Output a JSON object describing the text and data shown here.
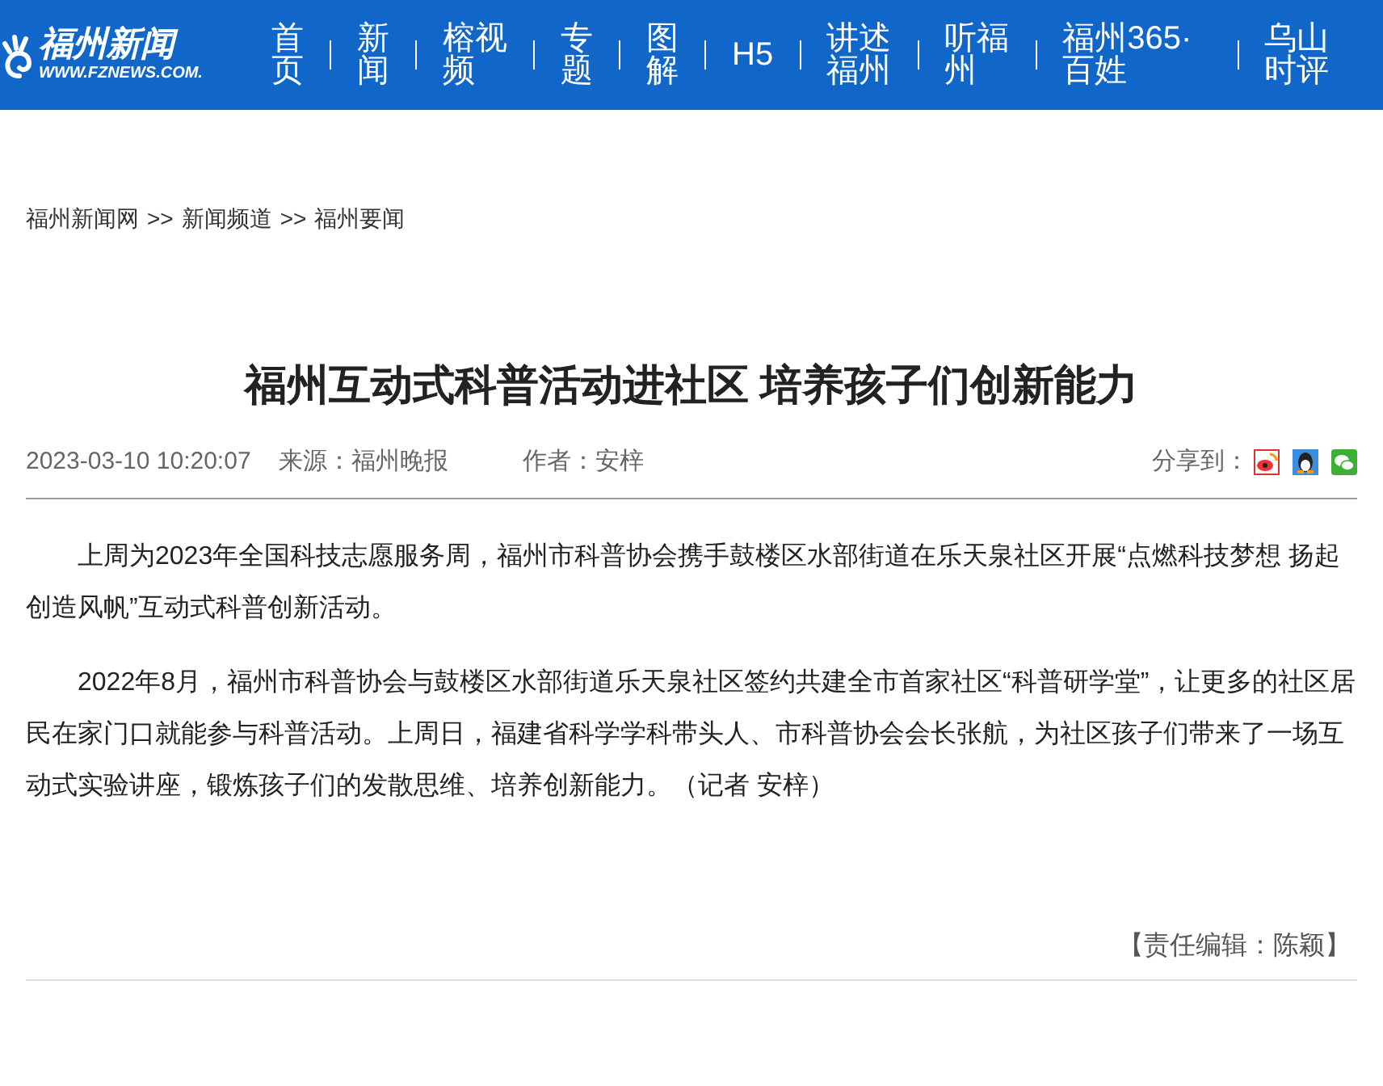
{
  "header": {
    "logo": {
      "name": "福州新闻",
      "url": "WWW.FZNEWS.COM."
    },
    "nav": [
      {
        "label": "首页"
      },
      {
        "label": "新闻"
      },
      {
        "label": "榕视频"
      },
      {
        "label": "专题"
      },
      {
        "label": "图解"
      },
      {
        "label": "H5"
      },
      {
        "label": "讲述福州"
      },
      {
        "label": "听福州"
      },
      {
        "label": "福州365·百姓"
      },
      {
        "label": "乌山时评"
      }
    ]
  },
  "breadcrumb": [
    {
      "label": "福州新闻网"
    },
    {
      "label": ">>"
    },
    {
      "label": "新闻频道"
    },
    {
      "label": ">>"
    },
    {
      "label": "福州要闻"
    }
  ],
  "article": {
    "title": "福州互动式科普活动进社区 培养孩子们创新能力",
    "date": "2023-03-10 10:20:07",
    "source": "来源：福州晚报",
    "author": "作者：安梓",
    "share_label": "分享到：",
    "paragraphs": [
      "上周为2023年全国科技志愿服务周，福州市科普协会携手鼓楼区水部街道在乐天泉社区开展“点燃科技梦想 扬起创造风帆”互动式科普创新活动。",
      "2022年8月，福州市科普协会与鼓楼区水部街道乐天泉社区签约共建全市首家社区“科普研学堂”，让更多的社区居民在家门口就能参与科普活动。上周日，福建省科学学科带头人、市科普协会会长张航，为社区孩子们带来了一场互动式实验讲座，锻炼孩子们的发散思维、培养创新能力。（记者 安梓）"
    ],
    "editor": "【责任编辑：陈颖】"
  }
}
